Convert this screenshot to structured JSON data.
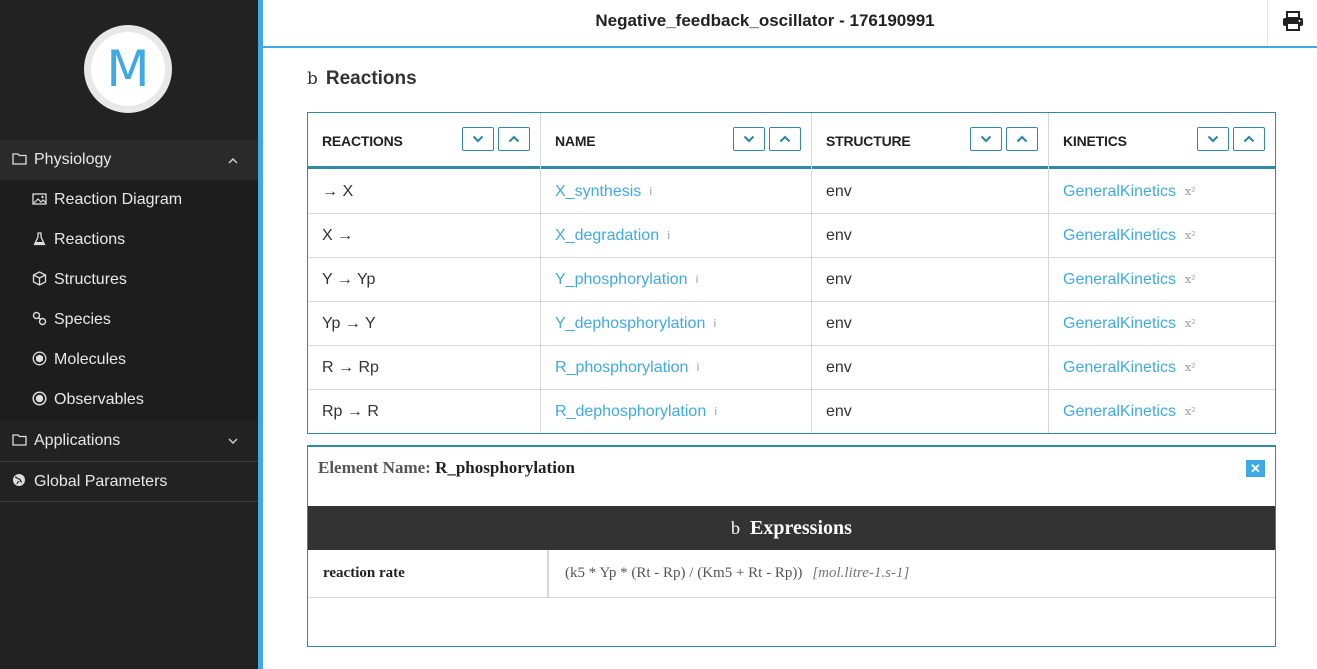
{
  "logo": {
    "letter": "M"
  },
  "header": {
    "title": "Negative_feedback_oscillator - 176190991"
  },
  "sidebar": {
    "items": [
      {
        "label": "Physiology",
        "icon": "folder-icon",
        "expanded": true
      },
      {
        "label": "Reaction Diagram",
        "icon": "image-icon"
      },
      {
        "label": "Reactions",
        "icon": "flask-icon"
      },
      {
        "label": "Structures",
        "icon": "cube-icon"
      },
      {
        "label": "Species",
        "icon": "link-icon"
      },
      {
        "label": "Molecules",
        "icon": "molecule-icon"
      },
      {
        "label": "Observables",
        "icon": "circle-dot-icon"
      },
      {
        "label": "Applications",
        "icon": "folder-icon",
        "expanded": false
      },
      {
        "label": "Global Parameters",
        "icon": "globe-icon"
      }
    ]
  },
  "section": {
    "prefix": "b",
    "title": "Reactions"
  },
  "table": {
    "headers": [
      "REACTIONS",
      "NAME",
      "STRUCTURE",
      "KINETICS"
    ],
    "rows": [
      {
        "reaction": "→ X",
        "name": "X_synthesis",
        "structure": "env",
        "kinetics": "GeneralKinetics"
      },
      {
        "reaction": "X →",
        "name": "X_degradation",
        "structure": "env",
        "kinetics": "GeneralKinetics"
      },
      {
        "reaction": "Y → Yp",
        "name": "Y_phosphorylation",
        "structure": "env",
        "kinetics": "GeneralKinetics"
      },
      {
        "reaction": "Yp → Y",
        "name": "Y_dephosphorylation",
        "structure": "env",
        "kinetics": "GeneralKinetics"
      },
      {
        "reaction": "R → Rp",
        "name": "R_phosphorylation",
        "structure": "env",
        "kinetics": "GeneralKinetics"
      },
      {
        "reaction": "Rp → R",
        "name": "R_dephosphorylation",
        "structure": "env",
        "kinetics": "GeneralKinetics"
      }
    ],
    "info_glyph": "i",
    "kinetics_glyph": "x²"
  },
  "detail": {
    "element_label": "Element Name:",
    "element_value": "R_phosphorylation",
    "close_glyph": "✕",
    "expressions_prefix": "b",
    "expressions_title": "Expressions",
    "row_label": "reaction rate",
    "row_value": "(k5 * Yp * (Rt - Rp) / (Km5 + Rt - Rp))",
    "row_unit": "[mol.litre-1.s-1]"
  },
  "colors": {
    "accent": "#3fa9e6",
    "table_border": "#2f8aa3",
    "sidebar_bg": "#222222"
  }
}
